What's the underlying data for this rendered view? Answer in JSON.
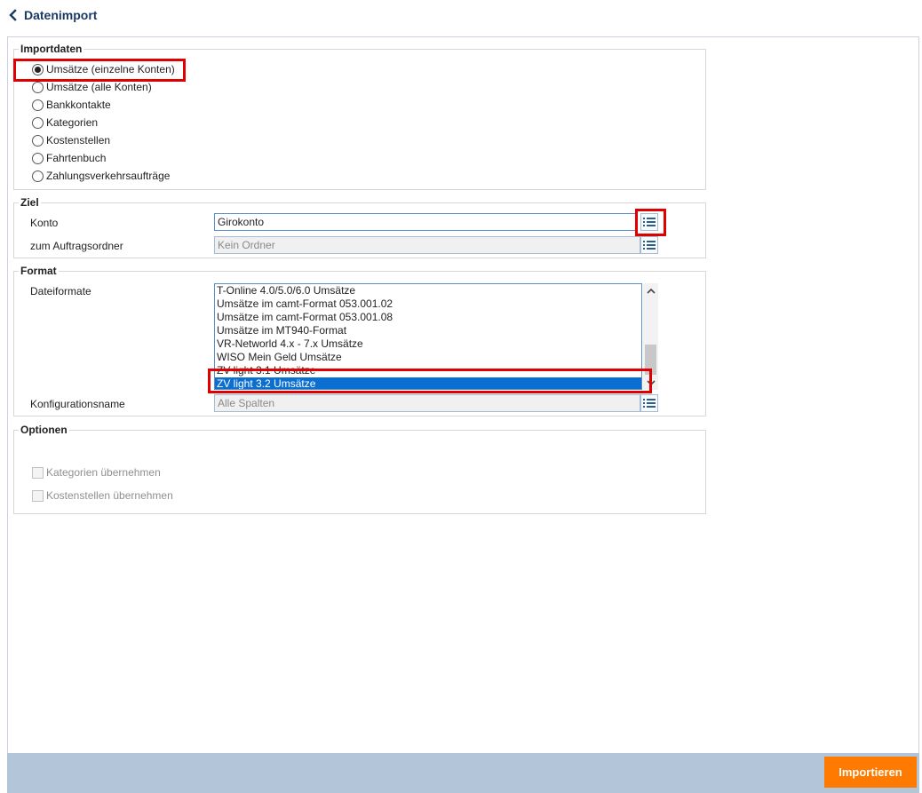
{
  "header": {
    "title": "Datenimport"
  },
  "import_data": {
    "legend": "Importdaten",
    "options": [
      {
        "label": "Umsätze (einzelne Konten)",
        "checked": true
      },
      {
        "label": "Umsätze (alle Konten)",
        "checked": false
      },
      {
        "label": "Bankkontakte",
        "checked": false
      },
      {
        "label": "Kategorien",
        "checked": false
      },
      {
        "label": "Kostenstellen",
        "checked": false
      },
      {
        "label": "Fahrtenbuch",
        "checked": false
      },
      {
        "label": "Zahlungsverkehrsaufträge",
        "checked": false
      }
    ]
  },
  "target": {
    "legend": "Ziel",
    "account_label": "Konto",
    "account_value": "Girokonto",
    "folder_label": "zum Auftragsordner",
    "folder_placeholder": "Kein Ordner"
  },
  "format": {
    "legend": "Format",
    "file_formats_label": "Dateiformate",
    "file_formats": [
      "T-Online 4.0/5.0/6.0 Umsätze",
      "Umsätze im camt-Format 053.001.02",
      "Umsätze im camt-Format 053.001.08",
      "Umsätze im MT940-Format",
      "VR-Networld 4.x - 7.x Umsätze",
      "WISO Mein Geld Umsätze",
      "ZV light 3.1 Umsätze",
      "ZV light 3.2 Umsätze"
    ],
    "selected_format": "ZV light 3.2 Umsätze",
    "config_label": "Konfigurationsname",
    "config_placeholder": "Alle Spalten"
  },
  "options": {
    "legend": "Optionen",
    "take_categories": "Kategorien übernehmen",
    "take_cost_centers": "Kostenstellen übernehmen"
  },
  "footer": {
    "import_button": "Importieren"
  },
  "colors": {
    "accent": "#ff7a00",
    "title": "#1b3a63",
    "selection": "#0a6fd0",
    "highlight": "#e00000",
    "footer_bar": "#b3c5d9"
  }
}
